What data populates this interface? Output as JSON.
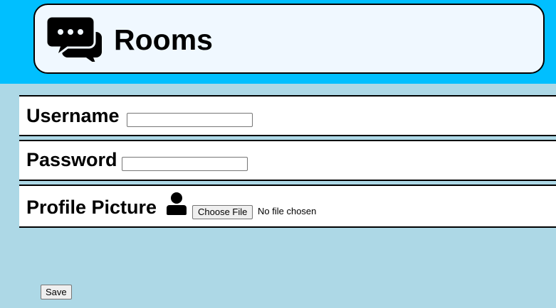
{
  "header": {
    "title": "Rooms",
    "icon": "comments-icon",
    "bar_color": "#00bfff",
    "card_color": "#f0f8ff"
  },
  "form": {
    "username_label": "Username",
    "username_value": "",
    "password_label": "Password",
    "password_value": "",
    "picture_label": "Profile Picture",
    "picture_icon": "user-icon",
    "file_button_label": "Choose File",
    "file_status": "No file chosen",
    "save_label": "Save"
  },
  "page": {
    "background": "#add8e6"
  }
}
